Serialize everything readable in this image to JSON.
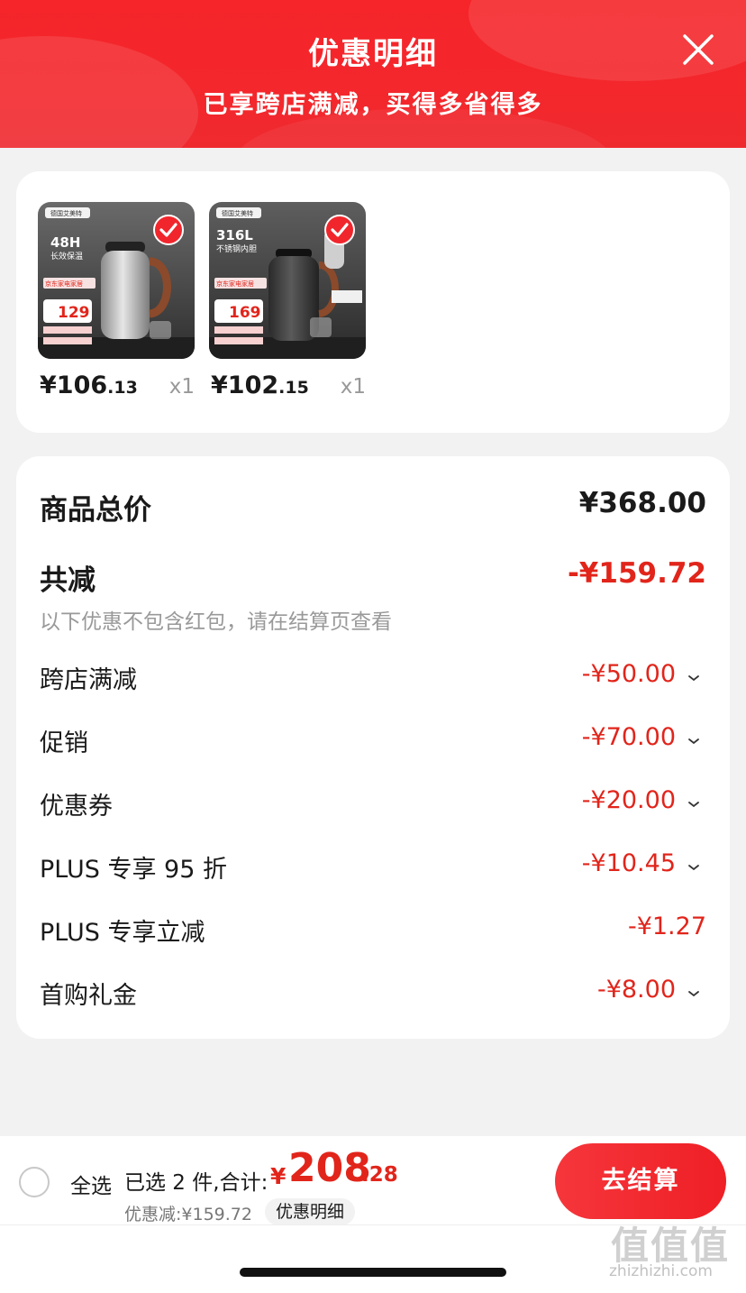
{
  "header": {
    "title": "优惠明细",
    "subtitle": "已享跨店满减，买得多省得多"
  },
  "products": [
    {
      "price_int": "¥106",
      "price_dec": ".13",
      "qty": "x1",
      "image": {
        "brand": "德国艾美特",
        "headline": "48H",
        "sub": "长效保温",
        "promo": "京东家电家居",
        "price": "129",
        "color": "silver"
      }
    },
    {
      "price_int": "¥102",
      "price_dec": ".15",
      "qty": "x1",
      "image": {
        "brand": "德国艾美特",
        "headline": "316L",
        "sub": "不锈钢内胆",
        "promo": "京东家电家居",
        "price": "169",
        "color": "black"
      }
    }
  ],
  "summary": {
    "total_label": "商品总价",
    "total_value": "¥368.00",
    "reduce_label": "共减",
    "reduce_value": "-¥159.72",
    "note": "以下优惠不包含红包，请在结算页查看",
    "items": [
      {
        "label": "跨店满减",
        "value": "-¥50.00",
        "expandable": true
      },
      {
        "label": "促销",
        "value": "-¥70.00",
        "expandable": true
      },
      {
        "label": "优惠券",
        "value": "-¥20.00",
        "expandable": true
      },
      {
        "label": "PLUS 专享 95 折",
        "value": "-¥10.45",
        "expandable": true
      },
      {
        "label": "PLUS 专享立减",
        "value": "-¥1.27",
        "expandable": false
      },
      {
        "label": "首购礼金",
        "value": "-¥8.00",
        "expandable": true
      }
    ]
  },
  "bottom": {
    "select_all": "全选",
    "selected": "已选 2 件,合计:",
    "currency": "¥",
    "total_int": "208",
    "total_dec": ".28",
    "discount": "优惠减:¥159.72",
    "detail_chip": "优惠明细",
    "checkout": "去结算"
  },
  "watermark": {
    "glyphs": "值值值",
    "text": "zhizhizhi.com"
  },
  "colors": {
    "accent": "#f0262c",
    "price_red": "#e1251b",
    "background": "#f2f2f2"
  },
  "icons": [
    "close-icon",
    "check-icon",
    "chevron-down-icon",
    "radio-icon"
  ]
}
